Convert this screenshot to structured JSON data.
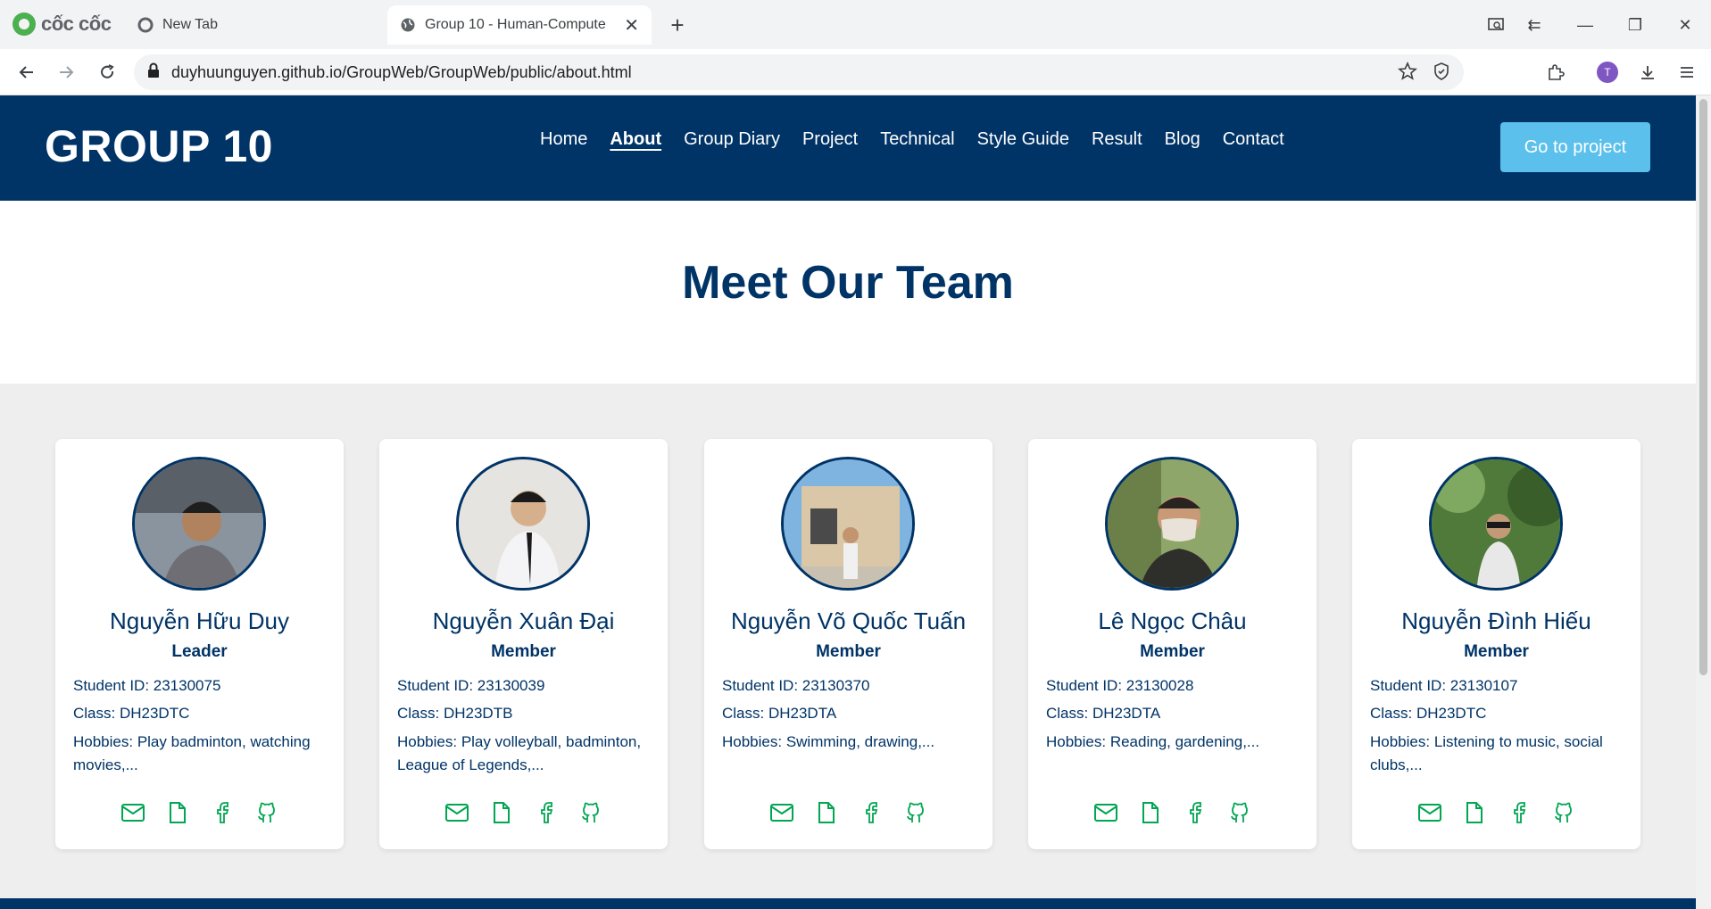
{
  "browser": {
    "brand": "cốc cốc",
    "tabs": [
      {
        "title": "New Tab"
      },
      {
        "title": "Group 10 - Human-Compute"
      }
    ],
    "url": "duyhuunguyen.github.io/GroupWeb/GroupWeb/public/about.html",
    "profile_initial": "T"
  },
  "site": {
    "logo": "GROUP 10",
    "nav": [
      "Home",
      "About",
      "Group Diary",
      "Project",
      "Technical",
      "Style Guide",
      "Result",
      "Blog",
      "Contact"
    ],
    "active_nav": "About",
    "cta": "Go to project"
  },
  "hero": {
    "title": "Meet Our Team"
  },
  "members": [
    {
      "name": "Nguyễn Hữu Duy",
      "role": "Leader",
      "student_id": "Student ID: 23130075",
      "class": "Class: DH23DTC",
      "hobbies": "Hobbies: Play badminton, watching movies,..."
    },
    {
      "name": "Nguyễn Xuân Đại",
      "role": "Member",
      "student_id": "Student ID: 23130039",
      "class": "Class: DH23DTB",
      "hobbies": "Hobbies: Play volleyball, badminton, League of Legends,..."
    },
    {
      "name": "Nguyễn Võ Quốc Tuấn",
      "role": "Member",
      "student_id": "Student ID: 23130370",
      "class": "Class: DH23DTA",
      "hobbies": "Hobbies: Swimming, drawing,..."
    },
    {
      "name": "Lê Ngọc Châu",
      "role": "Member",
      "student_id": "Student ID: 23130028",
      "class": "Class: DH23DTA",
      "hobbies": "Hobbies: Reading, gardening,..."
    },
    {
      "name": "Nguyễn Đình Hiếu",
      "role": "Member",
      "student_id": "Student ID: 23130107",
      "class": "Class: DH23DTC",
      "hobbies": "Hobbies: Listening to music, social clubs,..."
    }
  ],
  "icons": {
    "social": [
      "email-icon",
      "document-icon",
      "facebook-icon",
      "github-icon"
    ],
    "social_color": "#00a651"
  },
  "colors": {
    "brand_navy": "#003366",
    "cta_blue": "#5bc0eb",
    "section_bg": "#eeeeee"
  }
}
